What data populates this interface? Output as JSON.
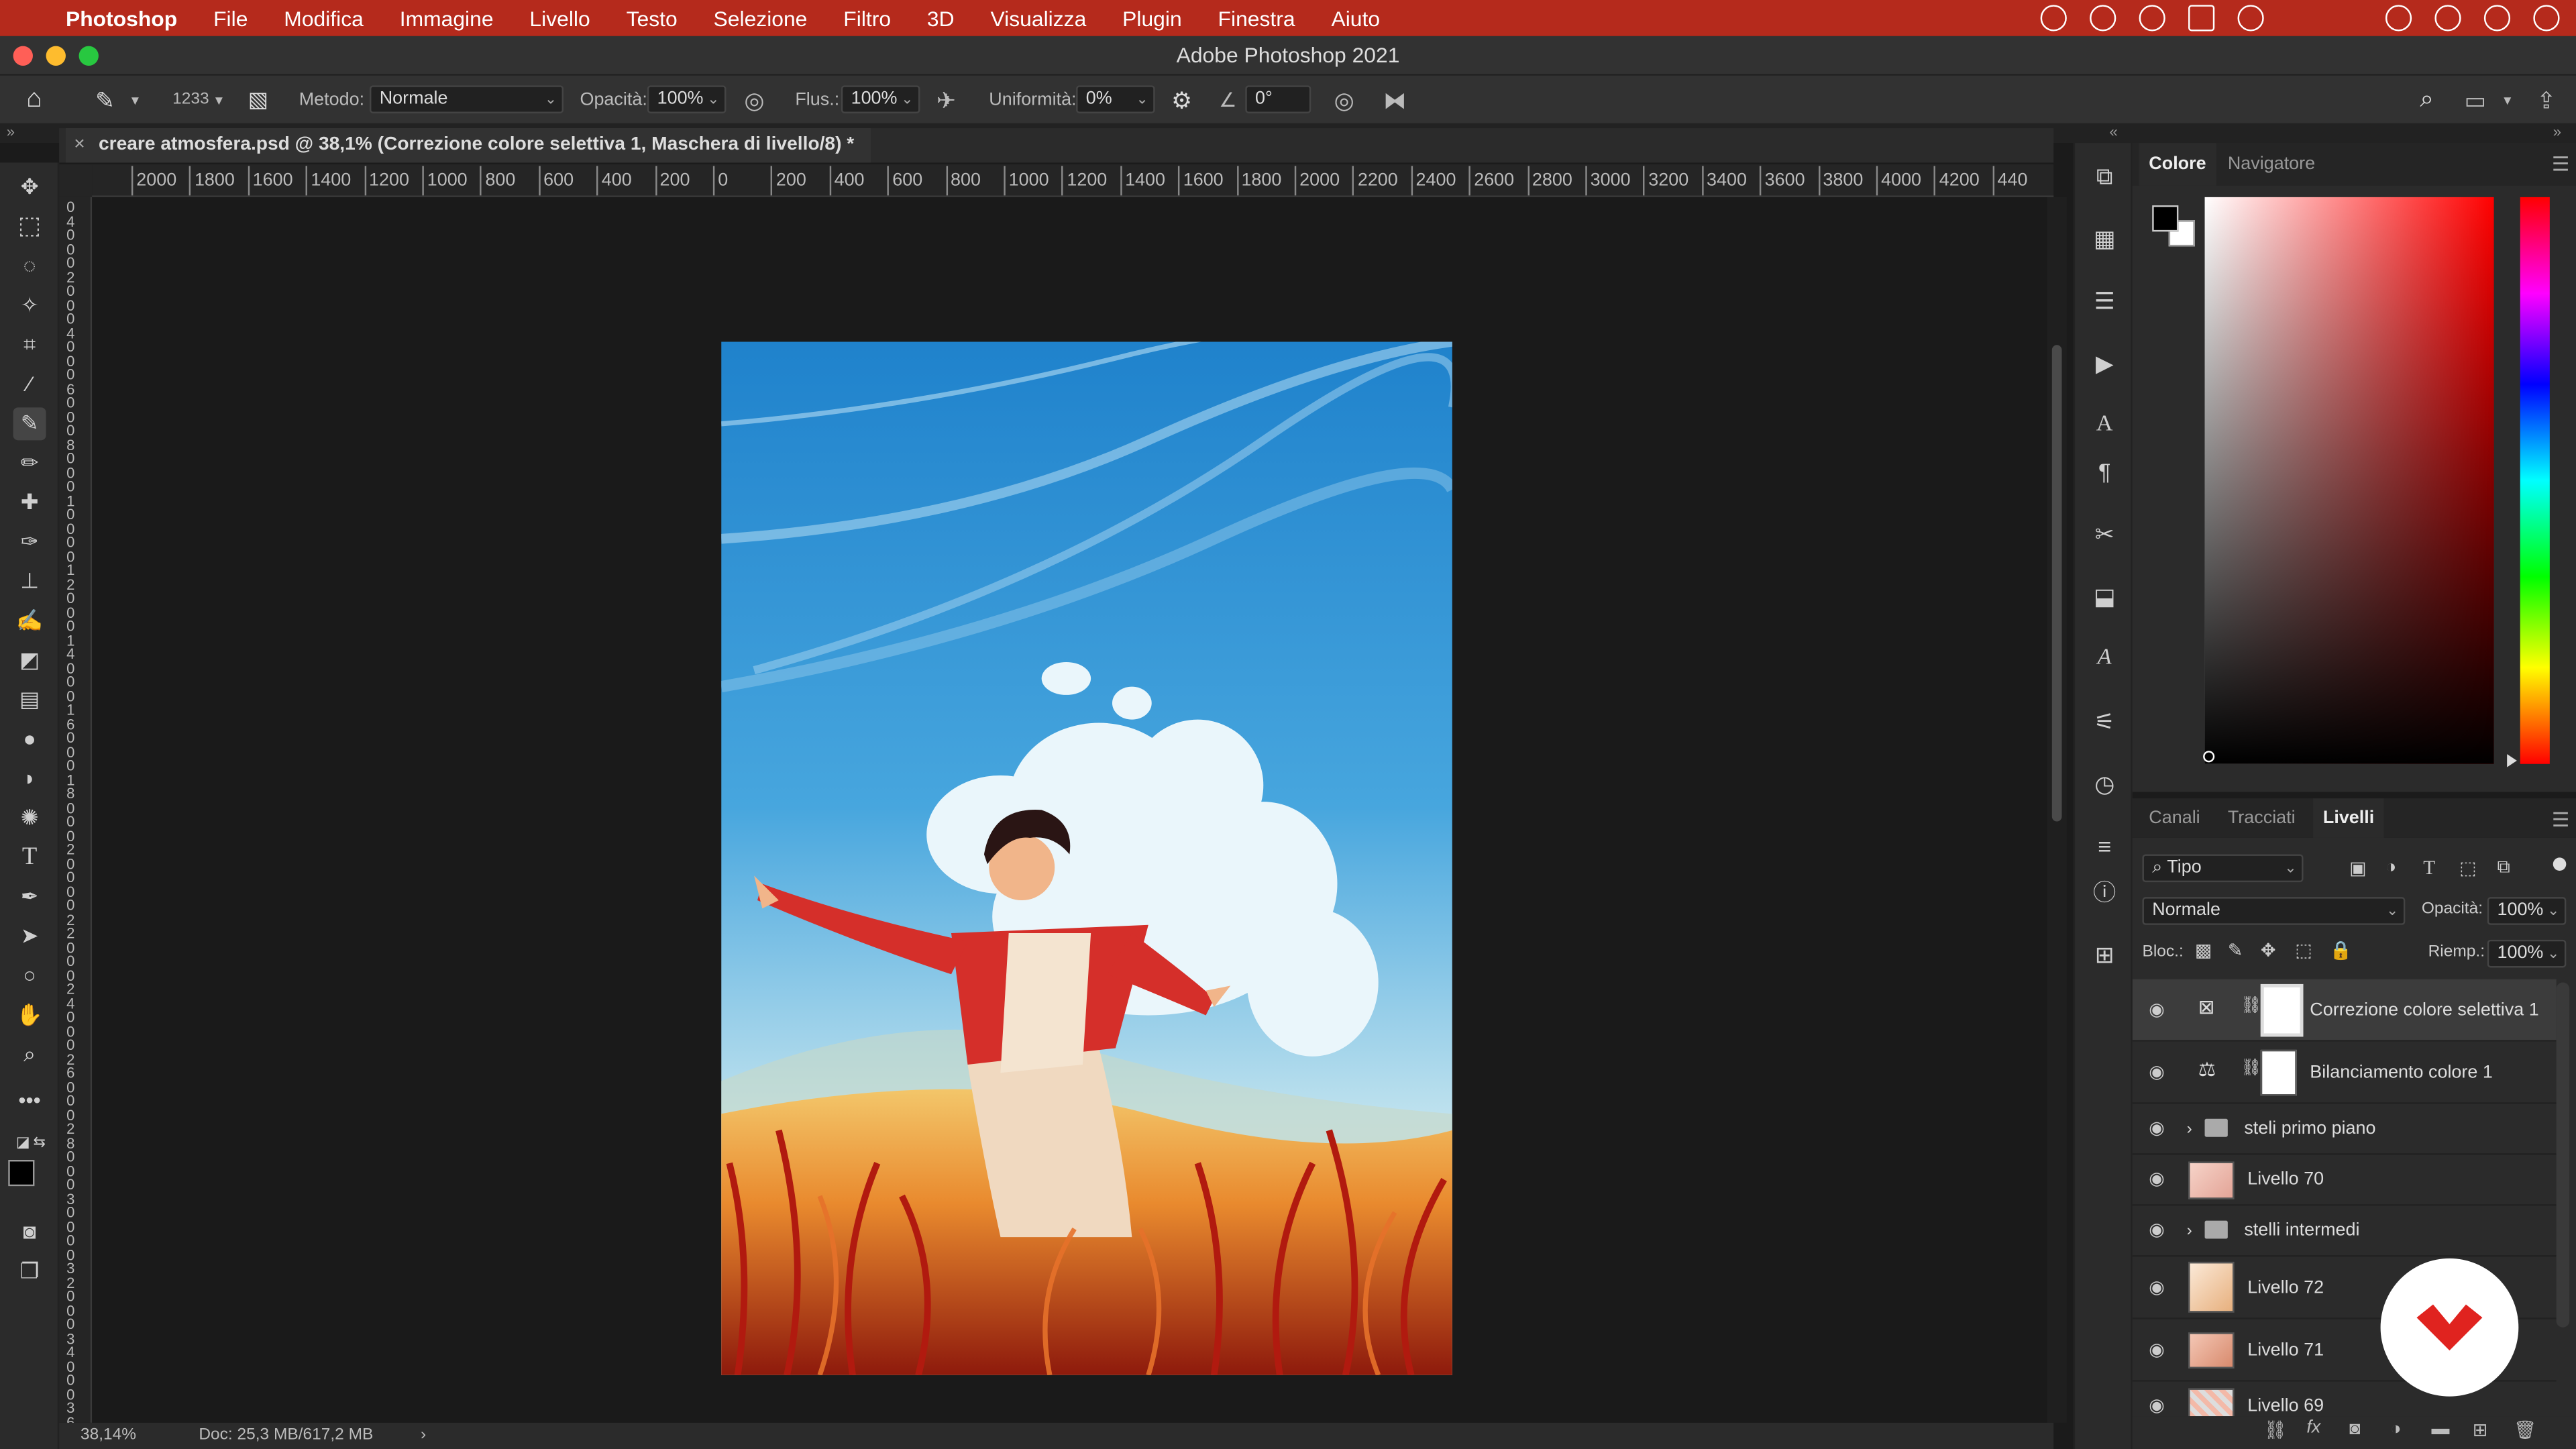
{
  "menubar": {
    "app": "Photoshop",
    "items": [
      "File",
      "Modifica",
      "Immagine",
      "Livello",
      "Testo",
      "Selezione",
      "Filtro",
      "3D",
      "Visualizza",
      "Plugin",
      "Finestra",
      "Aiuto"
    ]
  },
  "window": {
    "title": "Adobe Photoshop 2021"
  },
  "options": {
    "brush_size": "1233",
    "mode_label": "Metodo:",
    "mode_value": "Normale",
    "opacity_label": "Opacità:",
    "opacity_value": "100%",
    "flow_label": "Flus.:",
    "flow_value": "100%",
    "smooth_label": "Uniformità:",
    "smooth_value": "0%",
    "angle_value": "0°"
  },
  "document": {
    "tab_title": "creare atmosfera.psd @ 38,1% (Correzione colore selettiva 1, Maschera di livello/8) *",
    "close": "×"
  },
  "ruler": {
    "h_labels": [
      "2000",
      "1800",
      "1600",
      "1400",
      "1200",
      "1000",
      "800",
      "600",
      "400",
      "200",
      "0",
      "200",
      "400",
      "600",
      "800",
      "1000",
      "1200",
      "1400",
      "1600",
      "1800",
      "2000",
      "2200",
      "2400",
      "2600",
      "2800",
      "3000",
      "3200",
      "3400",
      "3600",
      "3800",
      "4000",
      "4200",
      "440"
    ],
    "v_labels": [
      "0",
      "4",
      "0",
      "0",
      "0",
      "2",
      "0",
      "0",
      "0",
      "4",
      "0",
      "0",
      "0",
      "6",
      "0",
      "0",
      "0",
      "8",
      "0",
      "0",
      "0",
      "1",
      "0",
      "0",
      "0",
      "0",
      "1",
      "2",
      "0",
      "0",
      "0",
      "1",
      "4",
      "0",
      "0",
      "0",
      "1",
      "6",
      "0",
      "0",
      "0",
      "1",
      "8",
      "0",
      "0",
      "0",
      "2",
      "0",
      "0",
      "0",
      "0",
      "2",
      "2",
      "0",
      "0",
      "0",
      "2",
      "4",
      "0",
      "0",
      "0",
      "2",
      "6",
      "0",
      "0",
      "0",
      "2",
      "8",
      "0",
      "0",
      "0",
      "3",
      "0",
      "0",
      "0",
      "0",
      "3",
      "2",
      "0",
      "0",
      "0",
      "3",
      "4",
      "0",
      "0",
      "0",
      "3",
      "6"
    ]
  },
  "status": {
    "zoom": "38,14%",
    "doc": "Doc: 25,3 MB/617,2 MB",
    "arrow": "›"
  },
  "color_panel": {
    "tabs": [
      "Colore",
      "Navigatore"
    ],
    "foreground": "#000000",
    "background": "#ffffff",
    "hue": "#ff0000"
  },
  "layers_panel": {
    "tabs": [
      "Canali",
      "Tracciati",
      "Livelli"
    ],
    "filter_label": "Tipo",
    "blend_mode": "Normale",
    "opacity_label": "Opacità:",
    "opacity_value": "100%",
    "lock_label": "Bloc.:",
    "fill_label": "Riemp.:",
    "fill_value": "100%",
    "layers": [
      {
        "name": "Correzione colore selettiva 1",
        "kind": "adjustment",
        "selected": true
      },
      {
        "name": "Bilanciamento colore 1",
        "kind": "adjustment",
        "selected": false
      },
      {
        "name": "steli primo piano",
        "kind": "group",
        "selected": false
      },
      {
        "name": "Livello 70",
        "kind": "pixel",
        "selected": false
      },
      {
        "name": "stelli intermedi",
        "kind": "group",
        "selected": false
      },
      {
        "name": "Livello 72",
        "kind": "pixel",
        "selected": false
      },
      {
        "name": "Livello 71",
        "kind": "pixel",
        "selected": false
      },
      {
        "name": "Livello 69",
        "kind": "pixel",
        "selected": false
      }
    ]
  }
}
